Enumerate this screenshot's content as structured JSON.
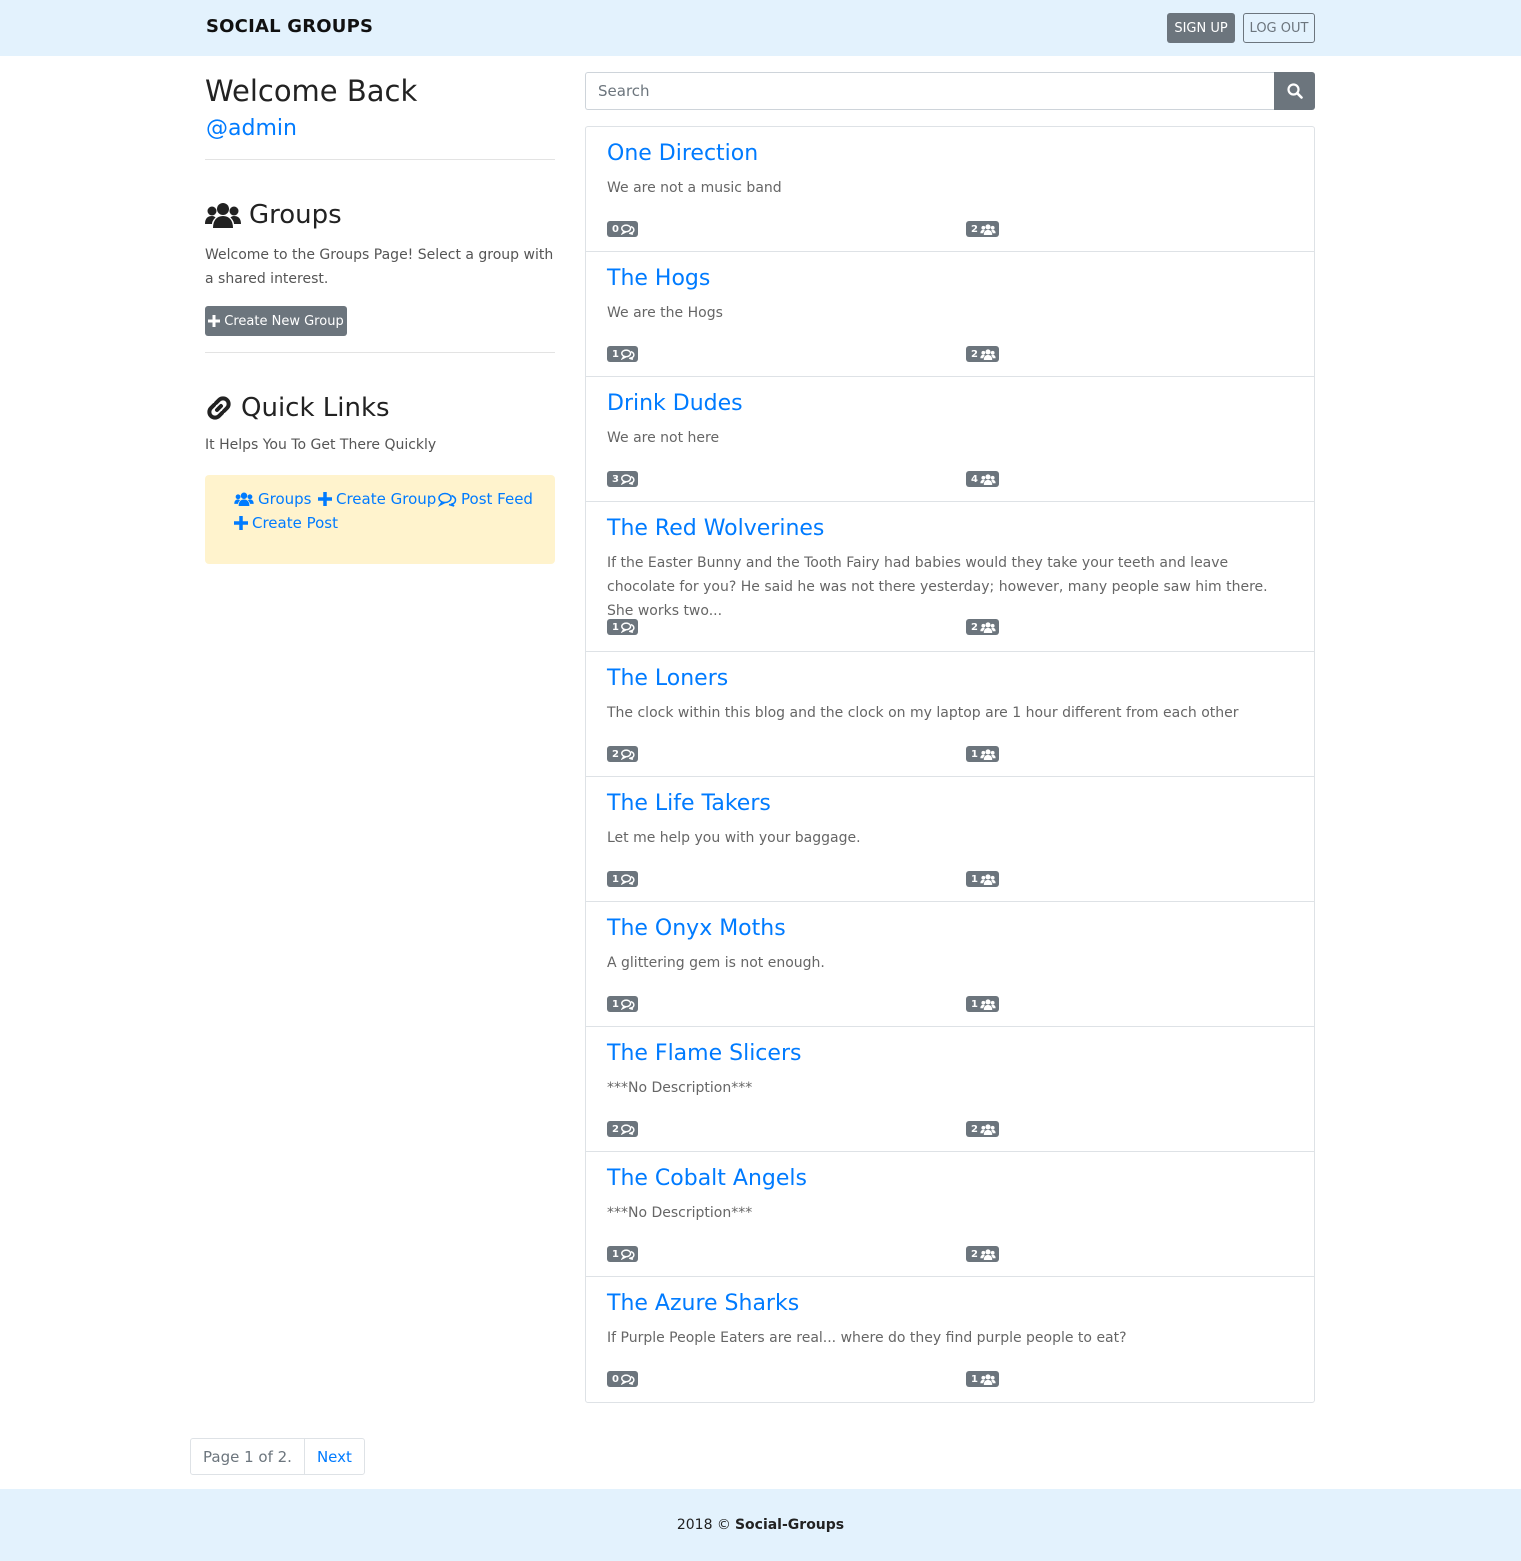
{
  "navbar": {
    "brand": "SOCIAL GROUPS",
    "signup_label": "SIGN UP",
    "logout_label": "LOG OUT"
  },
  "sidebar": {
    "welcome": "Welcome Back",
    "username": "@admin",
    "groups_title": "Groups",
    "groups_text": "Welcome to the Groups Page! Select a group with a shared interest.",
    "create_button": "Create New Group",
    "quicklinks_title": "Quick Links",
    "quicklinks_text": "It Helps You To Get There Quickly",
    "quicklinks": [
      {
        "label": "Groups",
        "icon": "users-icon"
      },
      {
        "label": "Create Group",
        "icon": "plus-icon"
      },
      {
        "label": "Post Feed",
        "icon": "comments-icon"
      },
      {
        "label": "Create Post",
        "icon": "plus-icon"
      }
    ]
  },
  "search": {
    "placeholder": "Search"
  },
  "groups": [
    {
      "title": "One Direction",
      "description": "We are not a music band",
      "posts": "0",
      "members": "2"
    },
    {
      "title": "The Hogs",
      "description": "We are the Hogs",
      "posts": "1",
      "members": "2"
    },
    {
      "title": "Drink Dudes",
      "description": "We are not here",
      "posts": "3",
      "members": "4"
    },
    {
      "title": "The Red Wolverines",
      "description": "If the Easter Bunny and the Tooth Fairy had babies would they take your teeth and leave chocolate for you? He said he was not there yesterday; however, many people saw him there. She works two...",
      "posts": "1",
      "members": "2"
    },
    {
      "title": "The Loners",
      "description": "The clock within this blog and the clock on my laptop are 1 hour different from each other",
      "posts": "2",
      "members": "1"
    },
    {
      "title": "The Life Takers",
      "description": "Let me help you with your baggage.",
      "posts": "1",
      "members": "1"
    },
    {
      "title": "The Onyx Moths",
      "description": "A glittering gem is not enough.",
      "posts": "1",
      "members": "1"
    },
    {
      "title": "The Flame Slicers",
      "description": "***No Description***",
      "posts": "2",
      "members": "2"
    },
    {
      "title": "The Cobalt Angels",
      "description": "***No Description***",
      "posts": "1",
      "members": "2"
    },
    {
      "title": "The Azure Sharks",
      "description": "If Purple People Eaters are real... where do they find purple people to eat?",
      "posts": "0",
      "members": "1"
    }
  ],
  "pager": {
    "info": "Page 1 of 2.",
    "next": "Next"
  },
  "footer": {
    "prefix": "2018 ©",
    "name": "Social-Groups"
  },
  "colors": {
    "navbar_bg": "#e3f2fd",
    "link": "#007bff",
    "secondary": "#6c757d",
    "warning_bg": "#fff3cd"
  }
}
